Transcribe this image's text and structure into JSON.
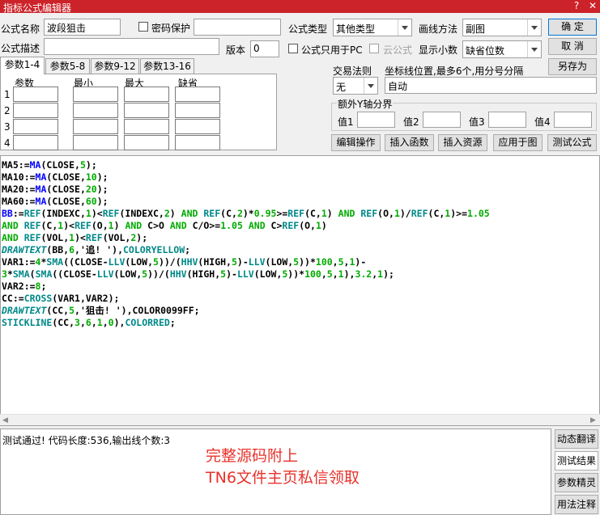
{
  "window": {
    "title": "指标公式编辑器",
    "help": "?",
    "close": "✕"
  },
  "form": {
    "name_label": "公式名称",
    "name_value": "波段狙击",
    "password_label": "密码保护",
    "desc_label": "公式描述",
    "desc_value": "",
    "version_label": "版本",
    "version_value": "0",
    "pc_only_label": "公式只用于PC",
    "cloud_label": "云公式",
    "type_label": "公式类型",
    "type_value": "其他类型",
    "draw_label": "画线方法",
    "draw_value": "副图",
    "decimals_label": "显示小数",
    "decimals_value": "缺省位数",
    "trade_label": "交易法则",
    "trade_value": "无",
    "coord_label": "坐标线位置,最多6个,用分号分隔",
    "coord_value": "自动",
    "yaxis_label": "额外Y轴分界",
    "y_values": [
      "值1",
      "值2",
      "值3",
      "值4"
    ]
  },
  "buttons": {
    "ok": "确  定",
    "cancel": "取  消",
    "save_as": "另存为",
    "edit_ops": "编辑操作",
    "insert_func": "插入函数",
    "insert_res": "插入资源",
    "apply_chart": "应用于图",
    "test": "测试公式"
  },
  "tabs": [
    "参数1-4",
    "参数5-8",
    "参数9-12",
    "参数13-16"
  ],
  "params": {
    "headers": [
      "参数",
      "最小",
      "最大",
      "缺省"
    ],
    "rows": [
      "1",
      "2",
      "3",
      "4"
    ]
  },
  "code_lines": [
    [
      [
        "MA5:=",
        "t"
      ],
      [
        "MA",
        "k"
      ],
      [
        "(CLOSE,",
        "t"
      ],
      [
        "5",
        "n"
      ],
      [
        ");",
        "t"
      ]
    ],
    [
      [
        "MA10:=",
        "t"
      ],
      [
        "MA",
        "k"
      ],
      [
        "(CLOSE,",
        "t"
      ],
      [
        "10",
        "n"
      ],
      [
        ");",
        "t"
      ]
    ],
    [
      [
        "MA20:=",
        "t"
      ],
      [
        "MA",
        "k"
      ],
      [
        "(CLOSE,",
        "t"
      ],
      [
        "20",
        "n"
      ],
      [
        ");",
        "t"
      ]
    ],
    [
      [
        "MA60:=",
        "t"
      ],
      [
        "MA",
        "k"
      ],
      [
        "(CLOSE,",
        "t"
      ],
      [
        "60",
        "n"
      ],
      [
        ");",
        "t"
      ]
    ],
    [
      [
        "BB",
        "k"
      ],
      [
        ":=",
        "t"
      ],
      [
        "REF",
        "f"
      ],
      [
        "(INDEXC,",
        "t"
      ],
      [
        "1",
        "n"
      ],
      [
        ")<",
        "t"
      ],
      [
        "REF",
        "f"
      ],
      [
        "(INDEXC,",
        "t"
      ],
      [
        "2",
        "n"
      ],
      [
        ") ",
        "t"
      ],
      [
        "AND",
        "n"
      ],
      [
        " ",
        "t"
      ],
      [
        "REF",
        "f"
      ],
      [
        "(C,",
        "t"
      ],
      [
        "2",
        "n"
      ],
      [
        ")*",
        "t"
      ],
      [
        "0.95",
        "n"
      ],
      [
        ">=",
        "t"
      ],
      [
        "REF",
        "f"
      ],
      [
        "(C,",
        "t"
      ],
      [
        "1",
        "n"
      ],
      [
        ") ",
        "t"
      ],
      [
        "AND",
        "n"
      ],
      [
        " ",
        "t"
      ],
      [
        "REF",
        "f"
      ],
      [
        "(O,",
        "t"
      ],
      [
        "1",
        "n"
      ],
      [
        ")/",
        "t"
      ],
      [
        "REF",
        "f"
      ],
      [
        "(C,",
        "t"
      ],
      [
        "1",
        "n"
      ],
      [
        ")>=",
        "t"
      ],
      [
        "1.05",
        "n"
      ]
    ],
    [
      [
        "AND",
        "n"
      ],
      [
        " ",
        "t"
      ],
      [
        "REF",
        "f"
      ],
      [
        "(C,",
        "t"
      ],
      [
        "1",
        "n"
      ],
      [
        ")<",
        "t"
      ],
      [
        "REF",
        "f"
      ],
      [
        "(O,",
        "t"
      ],
      [
        "1",
        "n"
      ],
      [
        ") ",
        "t"
      ],
      [
        "AND",
        "n"
      ],
      [
        " C>",
        "t"
      ],
      [
        "O",
        "t"
      ],
      [
        " ",
        "t"
      ],
      [
        "AND",
        "n"
      ],
      [
        " C/O>=",
        "t"
      ],
      [
        "1.05",
        "n"
      ],
      [
        " ",
        "t"
      ],
      [
        "AND",
        "n"
      ],
      [
        " C>",
        "t"
      ],
      [
        "REF",
        "f"
      ],
      [
        "(O,",
        "t"
      ],
      [
        "1",
        "n"
      ],
      [
        ")",
        "t"
      ]
    ],
    [
      [
        "AND",
        "n"
      ],
      [
        " ",
        "t"
      ],
      [
        "REF",
        "f"
      ],
      [
        "(VOL,",
        "t"
      ],
      [
        "1",
        "n"
      ],
      [
        ")<",
        "t"
      ],
      [
        "REF",
        "f"
      ],
      [
        "(VOL,",
        "t"
      ],
      [
        "2",
        "n"
      ],
      [
        ");",
        "t"
      ]
    ],
    [
      [
        "DRAWTEXT",
        "d"
      ],
      [
        "(BB,",
        "t"
      ],
      [
        "6",
        "n"
      ],
      [
        ",'追! '),",
        "t"
      ],
      [
        "COLORYELLOW",
        "f"
      ],
      [
        ";",
        "t"
      ]
    ],
    [
      [
        "VAR1:=",
        "t"
      ],
      [
        "4",
        "n"
      ],
      [
        "*",
        "t"
      ],
      [
        "SMA",
        "f"
      ],
      [
        "((CLOSE-",
        "t"
      ],
      [
        "LLV",
        "f"
      ],
      [
        "(LOW,",
        "t"
      ],
      [
        "5",
        "n"
      ],
      [
        "))/(",
        "t"
      ],
      [
        "HHV",
        "f"
      ],
      [
        "(HIGH,",
        "t"
      ],
      [
        "5",
        "n"
      ],
      [
        ")-",
        "t"
      ],
      [
        "LLV",
        "f"
      ],
      [
        "(LOW,",
        "t"
      ],
      [
        "5",
        "n"
      ],
      [
        "))*",
        "t"
      ],
      [
        "100",
        "n"
      ],
      [
        ",",
        "t"
      ],
      [
        "5",
        "n"
      ],
      [
        ",",
        "t"
      ],
      [
        "1",
        "n"
      ],
      [
        ")-",
        "t"
      ]
    ],
    [
      [
        "3",
        "n"
      ],
      [
        "*",
        "t"
      ],
      [
        "SMA",
        "f"
      ],
      [
        "(",
        "t"
      ],
      [
        "SMA",
        "f"
      ],
      [
        "((CLOSE-",
        "t"
      ],
      [
        "LLV",
        "f"
      ],
      [
        "(LOW,",
        "t"
      ],
      [
        "5",
        "n"
      ],
      [
        "))/(",
        "t"
      ],
      [
        "HHV",
        "f"
      ],
      [
        "(HIGH,",
        "t"
      ],
      [
        "5",
        "n"
      ],
      [
        ")-",
        "t"
      ],
      [
        "LLV",
        "f"
      ],
      [
        "(LOW,",
        "t"
      ],
      [
        "5",
        "n"
      ],
      [
        "))*",
        "t"
      ],
      [
        "100",
        "n"
      ],
      [
        ",",
        "t"
      ],
      [
        "5",
        "n"
      ],
      [
        ",",
        "t"
      ],
      [
        "1",
        "n"
      ],
      [
        "),",
        "t"
      ],
      [
        "3.2",
        "n"
      ],
      [
        ",",
        "t"
      ],
      [
        "1",
        "n"
      ],
      [
        ");",
        "t"
      ]
    ],
    [
      [
        "VAR2:=",
        "t"
      ],
      [
        "8",
        "n"
      ],
      [
        ";",
        "t"
      ]
    ],
    [
      [
        "CC:=",
        "t"
      ],
      [
        "CROSS",
        "f"
      ],
      [
        "(VAR1,VAR2);",
        "t"
      ]
    ],
    [
      [
        "DRAWTEXT",
        "d"
      ],
      [
        "(CC,",
        "t"
      ],
      [
        "5",
        "n"
      ],
      [
        ",'狙击! '),COLOR0099FF;",
        "t"
      ]
    ],
    [
      [
        "STICKLINE",
        "f"
      ],
      [
        "(CC,",
        "t"
      ],
      [
        "3",
        "n"
      ],
      [
        ",",
        "t"
      ],
      [
        "6",
        "n"
      ],
      [
        ",",
        "t"
      ],
      [
        "1",
        "n"
      ],
      [
        ",",
        "t"
      ],
      [
        "0",
        "n"
      ],
      [
        "),",
        "t"
      ],
      [
        "COLORRED",
        "f"
      ],
      [
        ";",
        "t"
      ]
    ]
  ],
  "result": {
    "message": "测试通过! 代码长度:536,输出线个数:3",
    "overlay_line1": "完整源码附上",
    "overlay_line2": "TN6文件主页私信领取"
  },
  "side_buttons": [
    "动态翻译",
    "测试结果",
    "参数精灵",
    "用法注释"
  ],
  "colors": {
    "titlebar": "#cc2229",
    "keyword": "#0000ff",
    "function": "#008888",
    "number": "#00aa00",
    "overlay": "#e8322b"
  }
}
